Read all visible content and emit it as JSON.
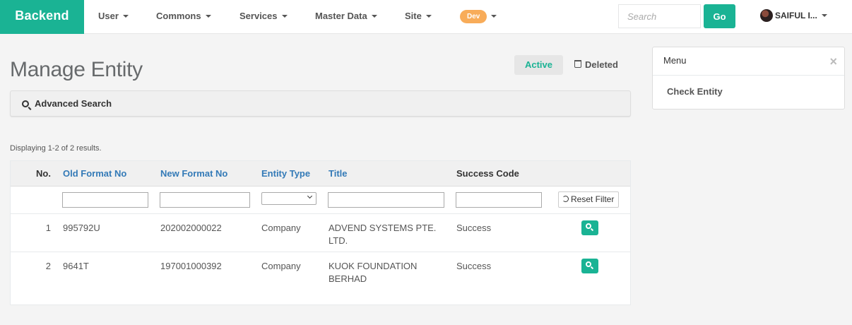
{
  "brand": "Backend",
  "nav": {
    "items": [
      "User",
      "Commons",
      "Services",
      "Master Data",
      "Site"
    ],
    "env_badge": "Dev",
    "search_placeholder": "Search",
    "go_label": "Go",
    "user_name": "SAIFUL I..."
  },
  "page": {
    "title": "Manage Entity",
    "tab_active": "Active",
    "tab_deleted": "Deleted",
    "advanced_search": "Advanced Search",
    "summary": "Displaying 1-2 of 2 results."
  },
  "table": {
    "headers": [
      "No.",
      "Old Format No",
      "New Format No",
      "Entity Type",
      "Title",
      "Success Code"
    ],
    "reset_filter": "Reset Filter",
    "rows": [
      {
        "no": "1",
        "old": "995792U",
        "new": "202002000022",
        "type": "Company",
        "title": "ADVEND SYSTEMS PTE. LTD.",
        "code": "Success"
      },
      {
        "no": "2",
        "old": "9641T",
        "new": "197001000392",
        "type": "Company",
        "title": "KUOK FOUNDATION BERHAD",
        "code": "Success"
      }
    ]
  },
  "side_menu": {
    "title": "Menu",
    "close": "×",
    "link": "Check Entity"
  },
  "colors": {
    "accent": "#1ab394",
    "link": "#337ab7",
    "badge": "#f8ac59"
  }
}
